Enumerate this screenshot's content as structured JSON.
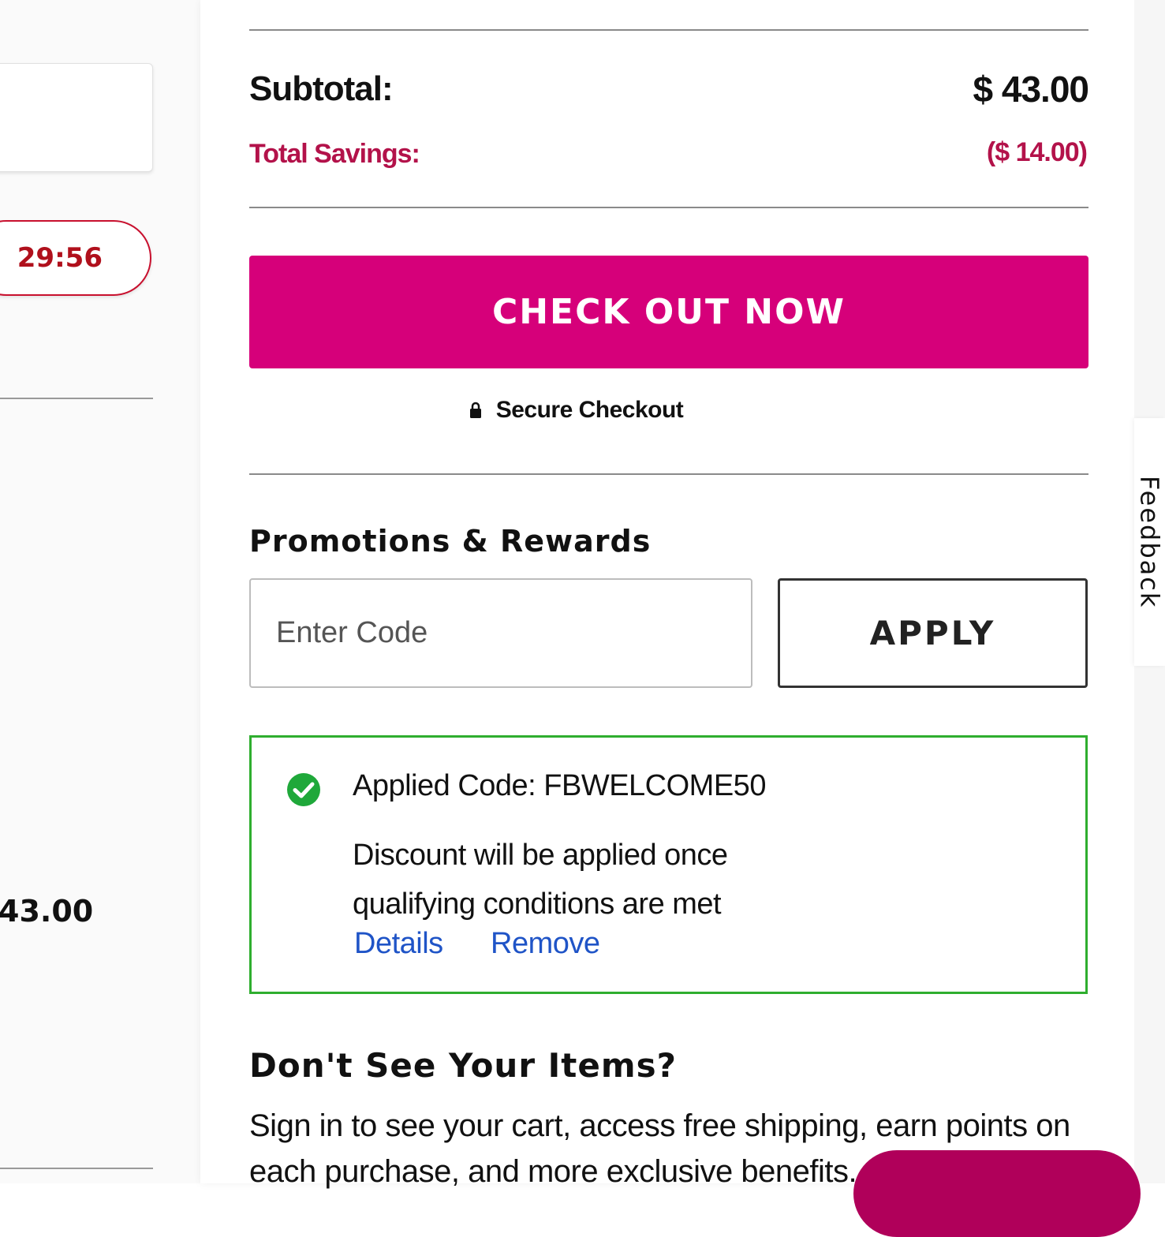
{
  "left": {
    "timer": "29:56",
    "price_partial": "43.00"
  },
  "summary": {
    "subtotal_label": "Subtotal:",
    "subtotal_value": "$ 43.00",
    "savings_label": "Total Savings:",
    "savings_value": "($ 14.00)"
  },
  "checkout": {
    "button_label": "CHECK OUT NOW",
    "secure_label": "Secure Checkout"
  },
  "promotions": {
    "title": "Promotions & Rewards",
    "input_placeholder": "Enter Code",
    "input_value": "",
    "apply_label": "APPLY",
    "applied": {
      "title": "Applied Code: FBWELCOME50",
      "message": "Discount will be applied once qualifying conditions are met",
      "details_label": "Details",
      "remove_label": "Remove"
    }
  },
  "signin": {
    "title": "Don't See Your Items?",
    "text": "Sign in to see your cart, access free shipping, earn points on each purchase, and more exclusive benefits."
  },
  "feedback": {
    "label": "Feedback"
  },
  "colors": {
    "brand": "#d6007a",
    "savings": "#b3124a",
    "success": "#2fae2f",
    "link": "#1f54c7",
    "timer": "#b0101c"
  },
  "icons": [
    "lock-icon",
    "check-circle-icon"
  ]
}
